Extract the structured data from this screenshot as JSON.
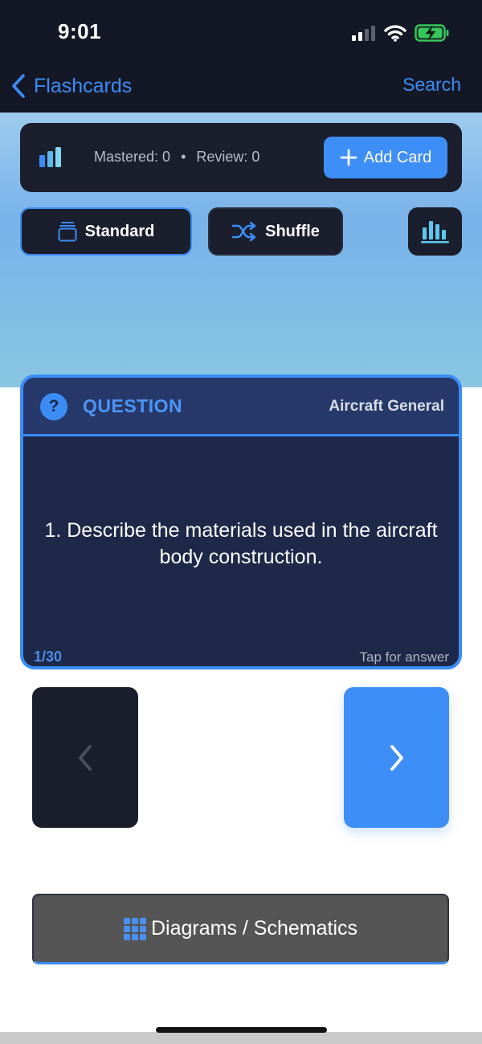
{
  "status_bar": {
    "time": "9:01"
  },
  "nav": {
    "back_label": "Flashcards",
    "search_label": "Search"
  },
  "stats": {
    "mastered": "Mastered: 0",
    "separator": "•",
    "review": "Review: 0"
  },
  "actions": {
    "add_card": "Add Card"
  },
  "modes": {
    "standard": "Standard",
    "shuffle": "Shuffle",
    "selected": "Standard"
  },
  "card": {
    "label": "QUESTION",
    "category": "Aircraft General",
    "text": "1. Describe the materials used in the aircraft body construction.",
    "counter": "1/30",
    "hint": "Tap for answer"
  },
  "diagrams": {
    "label": "Diagrams / Schematics"
  },
  "colors": {
    "accent": "#3d8ef7",
    "dark": "#1b1e2c",
    "card": "#1e2849",
    "battery": "#34c759"
  },
  "icons": {
    "back": "chevron-left-icon",
    "stats": "bar-chart-icon",
    "add": "plus-icon",
    "standard": "card-stack-icon",
    "shuffle": "shuffle-icon",
    "prev": "chevron-left-icon",
    "next": "chevron-right-icon",
    "diagrams": "grid-icon"
  }
}
